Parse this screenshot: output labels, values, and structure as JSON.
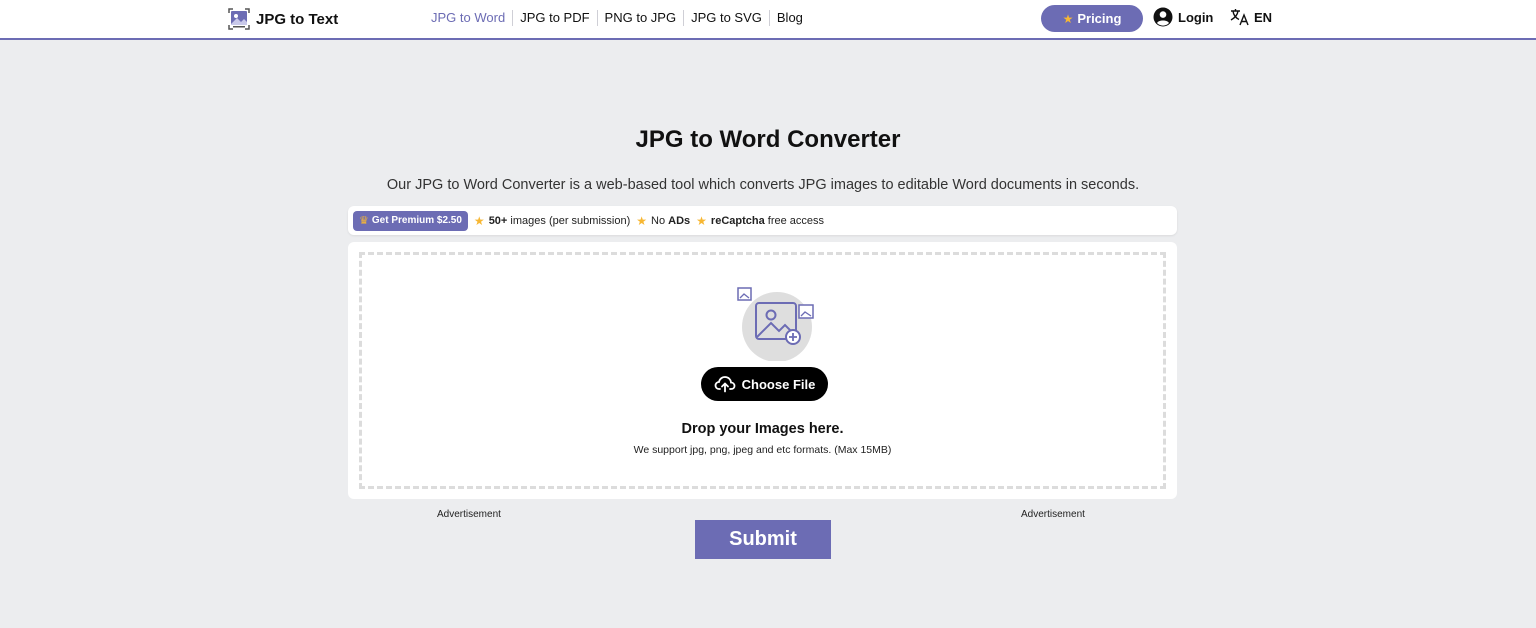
{
  "header": {
    "logo_text": "JPG to Text",
    "nav": [
      "JPG to Word",
      "JPG to PDF",
      "PNG to JPG",
      "JPG to SVG",
      "Blog"
    ],
    "pricing_label": "Pricing",
    "login_label": "Login",
    "language": "EN"
  },
  "main": {
    "title": "JPG to Word Converter",
    "subtitle": "Our JPG to Word Converter is a web-based tool which converts JPG images to editable Word documents in seconds."
  },
  "premium_bar": {
    "button_label": "Get Premium $2.50",
    "feature1_bold": "50+",
    "feature1_text": "images (per submission)",
    "feature2_text": "No",
    "feature2_bold": "ADs",
    "feature3_bold": "reCaptcha",
    "feature3_text": "free access"
  },
  "upload": {
    "choose_label": "Choose File",
    "drop_title": "Drop your Images here.",
    "drop_subtitle": "We support jpg, png, jpeg and etc formats. (Max 15MB)"
  },
  "ads": {
    "left": "Advertisement",
    "right": "Advertisement"
  },
  "submit_label": "Submit",
  "colors": {
    "accent": "#6c6cb4",
    "star": "#f7b733",
    "background": "#ecedef"
  }
}
